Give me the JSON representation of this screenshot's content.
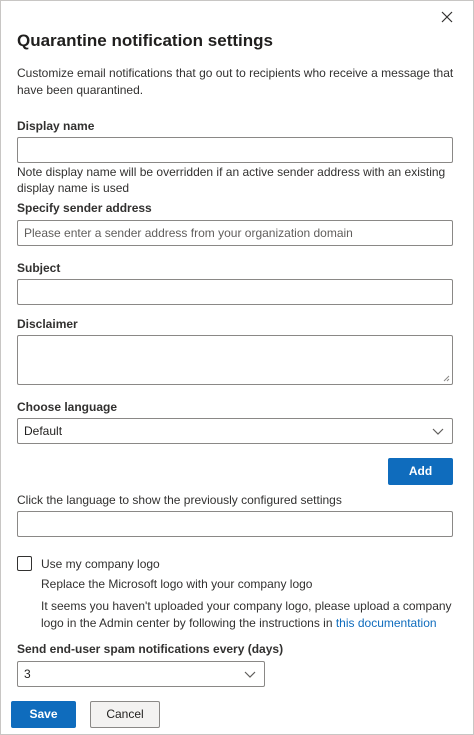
{
  "dialog": {
    "title": "Quarantine notification settings",
    "description": "Customize email notifications that go out to recipients who receive a message that have been quarantined."
  },
  "display_name": {
    "label": "Display name",
    "value": "",
    "note": "Note display name will be overridden if an active sender address with an existing display name is used"
  },
  "sender_address": {
    "label": "Specify sender address",
    "placeholder": "Please enter a sender address from your organization domain"
  },
  "subject": {
    "label": "Subject",
    "value": ""
  },
  "disclaimer": {
    "label": "Disclaimer",
    "value": ""
  },
  "language": {
    "label": "Choose language",
    "selected": "Default",
    "add_label": "Add",
    "configured_hint": "Click the language to show the previously configured settings"
  },
  "logo": {
    "checkbox_label": "Use my company logo",
    "checked": false,
    "replace_text": "Replace the Microsoft logo with your company logo",
    "upload_text": "It seems you haven't uploaded your company logo, please upload a company logo in the Admin center by following the instructions in ",
    "link_text": "this documentation"
  },
  "frequency": {
    "label": "Send end-user spam notifications every (days)",
    "selected": "3"
  },
  "footer": {
    "save_label": "Save",
    "cancel_label": "Cancel"
  },
  "icons": {
    "close": "close-icon",
    "chevron": "chevron-down-icon",
    "grip": "resize-grip-icon"
  },
  "colors": {
    "accent": "#0f6cbd",
    "border": "#8a8886"
  }
}
